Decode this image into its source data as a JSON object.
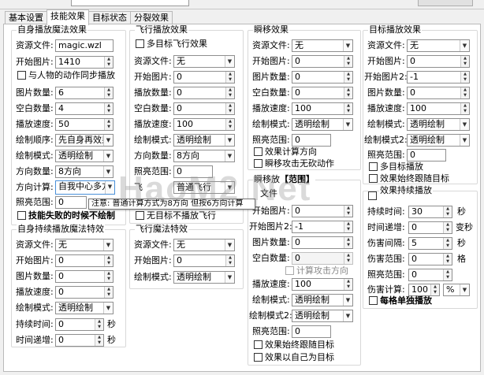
{
  "tabs": [
    "基本设置",
    "技能效果",
    "目标状态",
    "分裂效果"
  ],
  "g1": {
    "title": "自身播放魔法效果",
    "res_label": "资源文件:",
    "res_value": "magic.wzl",
    "start_label": "开始图片:",
    "start_value": "1410",
    "sync_label": "与人物的动作同步播放",
    "count_label": "图片数量:",
    "count_value": "6",
    "blank_label": "空白数量:",
    "blank_value": "4",
    "speed_label": "播放速度:",
    "speed_value": "50",
    "order_label": "绘制顺序:",
    "order_value": "先自身再效果",
    "mode_label": "绘制模式:",
    "mode_value": "透明绘制",
    "dir_label": "方向数量:",
    "dir_value": "8方向",
    "calc_label": "方向计算:",
    "calc_value": "自我中心多方向",
    "light_label": "照亮范围:",
    "light_value": "0",
    "fail_label": "技能失败的时候不绘制"
  },
  "g2": {
    "title": "自身持续播放魔法特效",
    "res_label": "资源文件:",
    "res_value": "无",
    "start_label": "开始图片:",
    "start_value": "0",
    "count_label": "图片数量:",
    "count_value": "0",
    "speed_label": "播放速度:",
    "speed_value": "0",
    "mode_label": "绘制模式:",
    "mode_value": "透明绘制",
    "dur_label": "持续时间:",
    "dur_value": "0",
    "dur_unit": "秒",
    "inc_label": "时间递增:",
    "inc_value": "0",
    "inc_unit": "秒"
  },
  "g3": {
    "title": "飞行播放效果",
    "multi_label": "多目标飞行效果",
    "res_label": "资源文件:",
    "res_value": "无",
    "start_label": "开始图片:",
    "start_value": "0",
    "count_label": "播放数量:",
    "count_value": "0",
    "blank_label": "空白数量:",
    "blank_value": "0",
    "speed_label": "播放速度:",
    "speed_value": "100",
    "mode_label": "绘制模式:",
    "mode_value": "透明绘制",
    "dir_label": "方向数量:",
    "dir_value": "8方向",
    "light_label": "照亮范围:",
    "light_value": "0",
    "flight_label": "飞",
    "flight_value": "普通飞行",
    "none_label": "无目标不播放飞行"
  },
  "tooltip": "注意: 普通计算方式为8方向 但按6方向计算",
  "g4": {
    "title": "飞行魔法特效",
    "res_label": "资源文件:",
    "res_value": "无",
    "start_label": "开始图片:",
    "start_value": "0",
    "mode_label": "绘制模式:",
    "mode_value": "透明绘制"
  },
  "g5": {
    "title": "瞬移效果",
    "res_label": "资源文件:",
    "res_value": "无",
    "start_label": "开始图片:",
    "start_value": "0",
    "count_label": "图片数量:",
    "count_value": "0",
    "blank_label": "空白数量:",
    "blank_value": "0",
    "speed_label": "播放速度:",
    "speed_value": "100",
    "mode_label": "绘制模式:",
    "mode_value": "透明绘制",
    "light_label": "照亮范围:",
    "light_value": "0",
    "calc_dir_label": "效果计算方向",
    "no_anim_label": "瞬移攻击无砍动作"
  },
  "g6": {
    "title_prefix": "瞬移放",
    "title_suffix": "【范围】",
    "res_label": "文件",
    "res_value": "",
    "start_label": "开始图片:",
    "start_value": "0",
    "start2_label": "开始图片2:",
    "start2_value": "-1",
    "count_label": "图片数量:",
    "count_value": "0",
    "blank_label": "空白数量:",
    "blank_value": "0",
    "calc_attack_label": "计算攻击方向",
    "speed_label": "播放速度:",
    "speed_value": "100",
    "mode_label": "绘制模式:",
    "mode_value": "透明绘制",
    "mode2_label": "绘制模式2:",
    "mode2_value": "透明绘制",
    "light_label": "照亮范围:",
    "light_value": "0",
    "follow_label": "效果始终跟随目标",
    "self_label": "效果以自己为目标"
  },
  "g7": {
    "title": "目标播放效果",
    "res_label": "资源文件:",
    "res_value": "无",
    "start_label": "开始图片:",
    "start_value": "0",
    "start2_label": "开始图片2:",
    "start2_value": "-1",
    "count_label": "图片数量:",
    "count_value": "0",
    "speed_label": "播放速度:",
    "speed_value": "100",
    "mode_label": "绘制模式:",
    "mode_value": "透明绘制",
    "mode2_label": "绘制模式2:",
    "mode2_value": "透明绘制",
    "light_label": "照亮范围:",
    "light_value": "0",
    "multi_label": "多目标播放",
    "follow_label": "效果始终跟随目标"
  },
  "g8": {
    "title": "效果持续播放",
    "dur_label": "持续时间:",
    "dur_value": "30",
    "dur_unit": "秒",
    "inc_label": "时间递增:",
    "inc_value": "0",
    "inc_unit": "变秒",
    "int_label": "伤害间隔:",
    "int_value": "5",
    "int_unit": "秒",
    "range_label": "伤害范围:",
    "range_value": "0",
    "range_unit": "格",
    "light_label": "照亮范围:",
    "light_value": "0",
    "calc_label": "伤害计算:",
    "calc_value": "100",
    "calc_unit": "%",
    "each_label": "每格单独播放"
  },
  "watermark": "HaoM2 Net"
}
